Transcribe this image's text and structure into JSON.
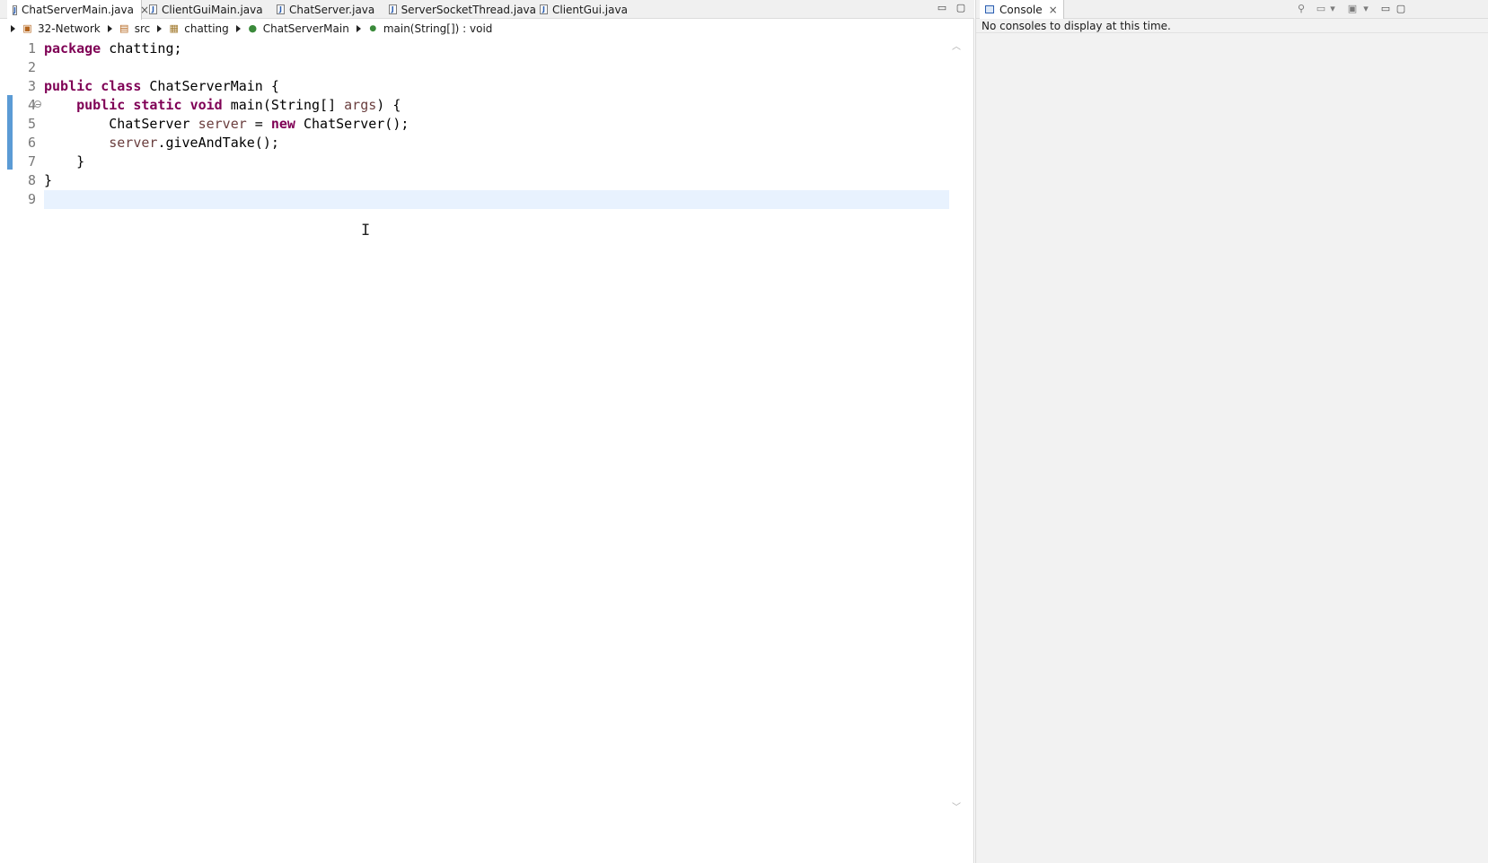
{
  "editor": {
    "tabs": [
      {
        "label": "ChatServerMain.java",
        "active": true
      },
      {
        "label": "ClientGuiMain.java",
        "active": false
      },
      {
        "label": "ChatServer.java",
        "active": false
      },
      {
        "label": "ServerSocketThread.java",
        "active": false
      },
      {
        "label": "ClientGui.java",
        "active": false
      }
    ],
    "tab_close_glyph": "×",
    "file_icon_glyph": "J",
    "minimize_glyph": "▭",
    "maximize_glyph": "▢"
  },
  "breadcrumb": {
    "items": [
      {
        "label": "32-Network",
        "icon": "project-icon"
      },
      {
        "label": "src",
        "icon": "source-folder-icon"
      },
      {
        "label": "chatting",
        "icon": "package-icon"
      },
      {
        "label": "ChatServerMain",
        "icon": "class-icon"
      },
      {
        "label": "main(String[]) : void",
        "icon": "method-icon"
      }
    ]
  },
  "code": {
    "line_numbers": [
      "1",
      "2",
      "3",
      "4",
      "5",
      "6",
      "7",
      "8",
      "9"
    ],
    "current_line": 9,
    "lines": [
      [
        {
          "t": "package",
          "c": "kw"
        },
        {
          "t": " chatting;",
          "c": ""
        }
      ],
      [],
      [
        {
          "t": "public",
          "c": "kw"
        },
        {
          "t": " ",
          "c": ""
        },
        {
          "t": "class",
          "c": "kw"
        },
        {
          "t": " ChatServerMain {",
          "c": ""
        }
      ],
      [
        {
          "t": "    ",
          "c": ""
        },
        {
          "t": "public",
          "c": "kw"
        },
        {
          "t": " ",
          "c": ""
        },
        {
          "t": "static",
          "c": "kw"
        },
        {
          "t": " ",
          "c": ""
        },
        {
          "t": "void",
          "c": "kw"
        },
        {
          "t": " main(String[] ",
          "c": ""
        },
        {
          "t": "args",
          "c": "var"
        },
        {
          "t": ") {",
          "c": ""
        }
      ],
      [
        {
          "t": "        ChatServer ",
          "c": ""
        },
        {
          "t": "server",
          "c": "var"
        },
        {
          "t": " = ",
          "c": ""
        },
        {
          "t": "new",
          "c": "kw"
        },
        {
          "t": " ChatServer();",
          "c": ""
        }
      ],
      [
        {
          "t": "        ",
          "c": ""
        },
        {
          "t": "server",
          "c": "var"
        },
        {
          "t": ".giveAndTake();",
          "c": ""
        }
      ],
      [
        {
          "t": "    }",
          "c": ""
        }
      ],
      [
        {
          "t": "}",
          "c": ""
        }
      ],
      []
    ]
  },
  "console": {
    "tab_label": "Console",
    "message": "No consoles to display at this time."
  },
  "colors": {
    "keyword": "#7f0055",
    "variable": "#6a3e3e",
    "current_line": "#e8f2fe",
    "change_marker": "#5b9bd5"
  }
}
